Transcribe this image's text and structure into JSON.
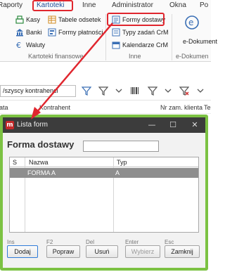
{
  "menu": {
    "items": [
      "Raporty",
      "Kartoteki",
      "Inne",
      "Administrator",
      "Okna",
      "Po"
    ],
    "active": "Kartoteki"
  },
  "ribbon": {
    "group1": {
      "items": [
        {
          "label": "Kasy",
          "icon": "cash-register-icon"
        },
        {
          "label": "Banki",
          "icon": "bank-icon"
        },
        {
          "label": "Waluty",
          "icon": "currency-euro-icon"
        },
        {
          "label": "Tabele odsetek",
          "icon": "interest-table-icon"
        },
        {
          "label": "Formy płatności",
          "icon": "payment-forms-icon"
        }
      ],
      "label": "Kartoteki finansowe"
    },
    "group2": {
      "items": [
        {
          "label": "Formy dostawy",
          "icon": "delivery-forms-icon"
        },
        {
          "label": "Typy zadań CrM",
          "icon": "task-types-icon"
        },
        {
          "label": "Kalendarze CrM",
          "icon": "calendar-icon"
        }
      ],
      "label": "Inne"
    },
    "group3": {
      "items": [
        {
          "label": "e-Dokument",
          "icon": "e-document-icon"
        }
      ],
      "label": "e-Dokumen"
    }
  },
  "list": {
    "filter_value": "/szyscy kontrahenci",
    "columns": [
      "ata",
      "Kontrahent",
      "Nr zam. klienta",
      "Te"
    ]
  },
  "dialog": {
    "title": "Lista form",
    "heading": "Forma dostawy",
    "search_value": "",
    "grid": {
      "columns": [
        "S",
        "Nazwa",
        "Typ"
      ],
      "rows": [
        {
          "s": "",
          "nazwa": "FORMA A",
          "typ": "A"
        }
      ]
    },
    "hotkeys": [
      "Ins",
      "F2",
      "Del",
      "Enter",
      "Esc"
    ],
    "buttons": {
      "add": "Dodaj",
      "edit": "Popraw",
      "delete": "Usuń",
      "select": "Wybierz",
      "close": "Zamknij"
    },
    "window_controls": {
      "minimize": "—",
      "maximize": "☐",
      "close": "✕"
    }
  },
  "colors": {
    "highlight": "#e0262e",
    "dialog_border": "#7cc243",
    "selected_row": "#8e8e8e",
    "titlebar": "#3c3c3c",
    "active_menu": "#1f4e9a"
  }
}
